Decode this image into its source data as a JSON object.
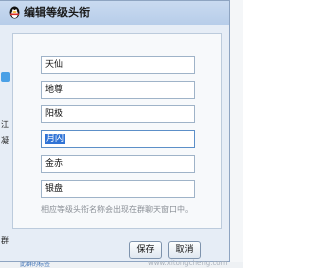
{
  "dialog": {
    "title": "编辑等级头衔",
    "fields": [
      {
        "value": "天仙"
      },
      {
        "value": "地尊"
      },
      {
        "value": "阳极"
      },
      {
        "value": "月闪",
        "selected": true
      },
      {
        "value": "金赤"
      },
      {
        "value": "银盘"
      }
    ],
    "hint": "相应等级头衔名称会出现在群聊天窗口中。",
    "buttons": {
      "save": "保存",
      "cancel": "取消"
    }
  },
  "background": {
    "left_text": [
      "江",
      "凝",
      "群"
    ],
    "bottom_link": "此群的标签"
  },
  "watermark": "www.xitongcheng.com",
  "colors": {
    "title_bar": "#b7cde9",
    "selection": "#3174d6"
  }
}
